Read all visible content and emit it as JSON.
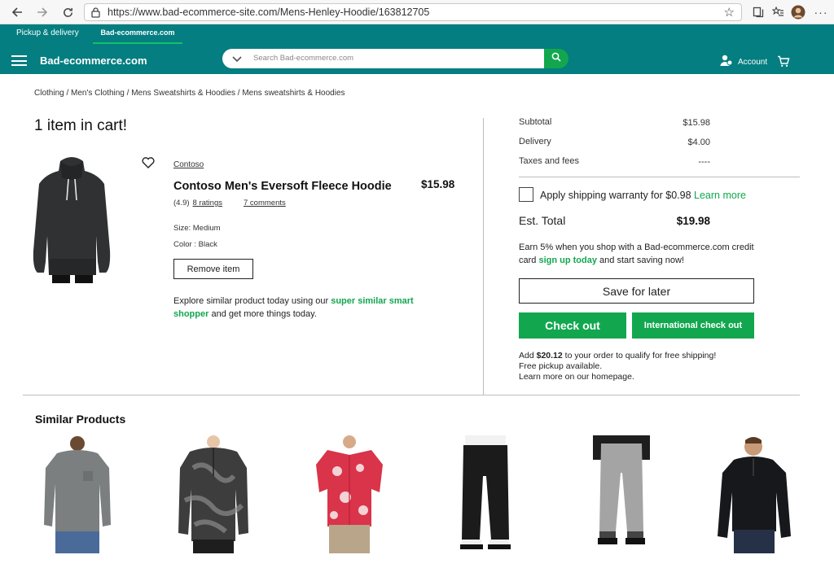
{
  "browser": {
    "url": "https://www.bad-ecommerce-site.com/Mens-Henley-Hoodie/163812705"
  },
  "header": {
    "tab_pickup": "Pickup & delivery",
    "tab_brand": "Bad-ecommerce.com",
    "logo": "Bad-ecommerce.com",
    "search_placeholder": "Search Bad-ecommerce.com",
    "account_label": "Account"
  },
  "breadcrumb": "Clothing / Men's Clothing / Mens Sweatshirts & Hoodies / Mens sweatshirts & Hoodies",
  "cart": {
    "title": "1 item in cart!",
    "item": {
      "brand": "Contoso",
      "name": "Contoso Men's Eversoft Fleece Hoodie",
      "price": "$15.98",
      "rating": "(4.9)",
      "ratings_link": "8 ratings",
      "comments_link": "7 comments",
      "size": "Size: Medium",
      "color": "Color : Black",
      "remove_label": "Remove item"
    },
    "explore_prefix": "Explore similar product today using our",
    "explore_link": "super similar smart shopper",
    "explore_suffix": "and get more things today."
  },
  "summary": {
    "subtotal_label": "Subtotal",
    "subtotal_value": "$15.98",
    "delivery_label": "Delivery",
    "delivery_value": "$4.00",
    "taxes_label": "Taxes and fees",
    "taxes_value": "----",
    "warranty_text": "Apply shipping warranty for $0.98",
    "warranty_link": "Learn more",
    "est_total_label": "Est. Total",
    "est_total_value": "$19.98",
    "earn_prefix": "Earn 5% when you shop with a Bad-ecommerce.com credit card",
    "earn_link": "sign up today",
    "earn_suffix": "and start saving now!",
    "save_later_label": "Save for later",
    "checkout_label": "Check out",
    "intl_checkout_label": "International check out",
    "ship_prefix": "Add",
    "ship_amount": "$20.12",
    "ship_suffix": "to your order to qualify for free shipping!",
    "ship_line2": "Free pickup available.",
    "ship_line3": "Learn more on our homepage."
  },
  "similar": {
    "title": "Similar Products"
  },
  "colors": {
    "brand_teal": "#047e80",
    "accent_green": "#12a74f"
  }
}
